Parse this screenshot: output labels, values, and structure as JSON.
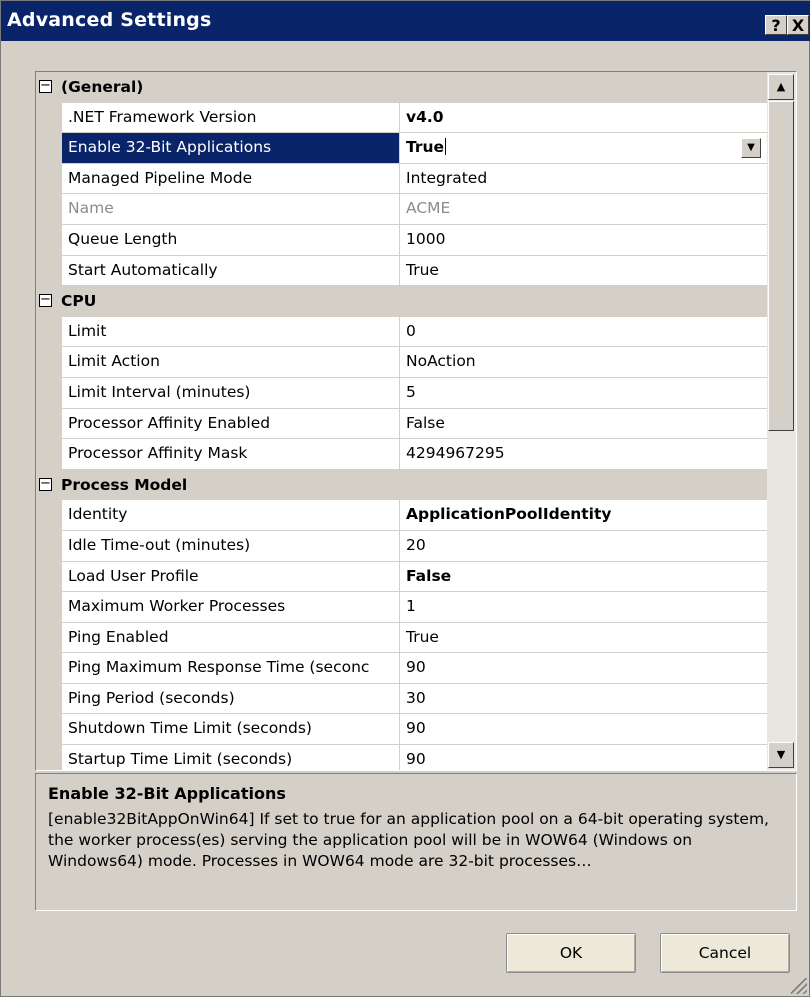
{
  "window": {
    "title": "Advanced Settings",
    "help_label": "?",
    "close_label": "X"
  },
  "grid": {
    "general": {
      "label": "(General)",
      "rows": [
        {
          "name": ".NET Framework Version",
          "value": "v4.0"
        },
        {
          "name": "Enable 32-Bit Applications",
          "value": "True"
        },
        {
          "name": "Managed Pipeline Mode",
          "value": "Integrated"
        },
        {
          "name": "Name",
          "value": "ACME"
        },
        {
          "name": "Queue Length",
          "value": "1000"
        },
        {
          "name": "Start Automatically",
          "value": "True"
        }
      ]
    },
    "cpu": {
      "label": "CPU",
      "rows": [
        {
          "name": "Limit",
          "value": "0"
        },
        {
          "name": "Limit Action",
          "value": "NoAction"
        },
        {
          "name": "Limit Interval (minutes)",
          "value": "5"
        },
        {
          "name": "Processor Affinity Enabled",
          "value": "False"
        },
        {
          "name": "Processor Affinity Mask",
          "value": "4294967295"
        }
      ]
    },
    "process_model": {
      "label": "Process Model",
      "rows": [
        {
          "name": "Identity",
          "value": "ApplicationPoolIdentity"
        },
        {
          "name": "Idle Time-out (minutes)",
          "value": "20"
        },
        {
          "name": "Load User Profile",
          "value": "False"
        },
        {
          "name": "Maximum Worker Processes",
          "value": "1"
        },
        {
          "name": "Ping Enabled",
          "value": "True"
        },
        {
          "name": "Ping Maximum Response Time (seconc",
          "value": "90"
        },
        {
          "name": "Ping Period (seconds)",
          "value": "30"
        },
        {
          "name": "Shutdown Time Limit (seconds)",
          "value": "90"
        },
        {
          "name": "Startup Time Limit (seconds)",
          "value": "90"
        }
      ]
    },
    "expand_glyph": "⊟"
  },
  "description": {
    "title": "Enable 32-Bit Applications",
    "text": "[enable32BitAppOnWin64] If set to true for an application pool on a 64-bit operating system, the worker process(es) serving the application pool will be in WOW64 (Windows on Windows64) mode. Processes in WOW64 mode are 32-bit processes…"
  },
  "buttons": {
    "ok": "OK",
    "cancel": "Cancel"
  },
  "colors": {
    "title_bar": "#0a246a",
    "selection": "#0a246a",
    "dialog_bg": "#d4d0c8"
  }
}
